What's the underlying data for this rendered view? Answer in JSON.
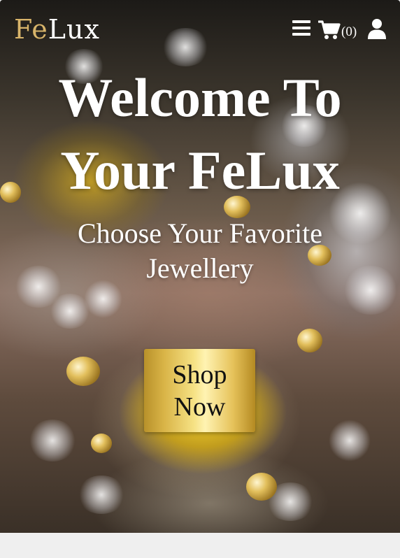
{
  "navbar": {
    "logo_part1": "Fe",
    "logo_part2": "Lux",
    "cart_count": "(0)",
    "icons": [
      "menu-icon",
      "cart-icon",
      "user-icon"
    ]
  },
  "hero": {
    "title": "Welcome To Your FeLux",
    "subtitle": "Choose Your Favorite Jewellery",
    "button_label": "Shop Now"
  },
  "colors": {
    "logo_accent": "#d8b46a",
    "text": "#ffffff",
    "button_gold": "#f6e285",
    "page_background": "#efefef"
  }
}
